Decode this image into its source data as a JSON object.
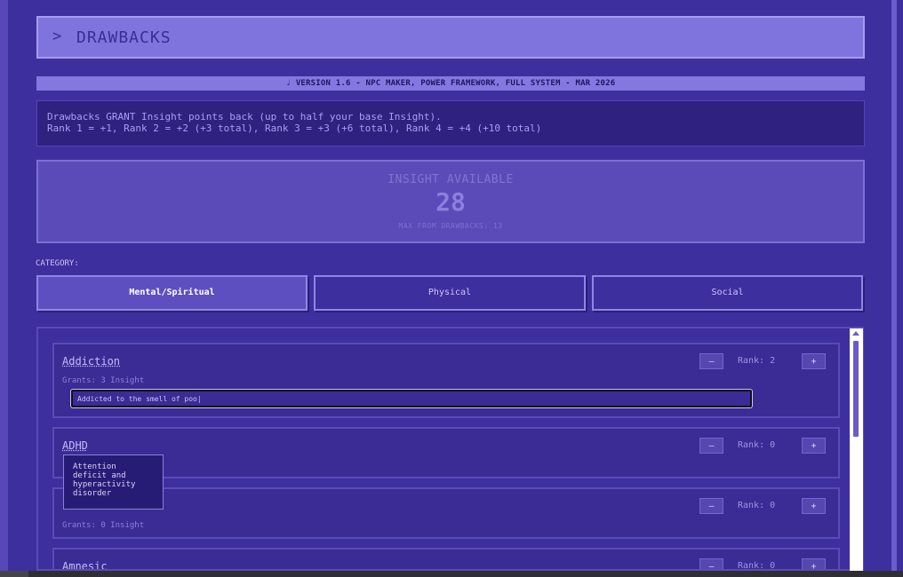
{
  "header": {
    "chevron": ">",
    "title": "DRAWBACKS"
  },
  "version": "♩ VERSION 1.6 - NPC MAKER, POWER FRAMEWORK, FULL SYSTEM - MAR 2026",
  "info": {
    "line1": "Drawbacks GRANT Insight points back (up to half your base Insight).",
    "line2": "Rank 1 = +1, Rank 2 = +2 (+3 total), Rank 3 = +3 (+6 total), Rank 4 = +4 (+10 total)"
  },
  "insight": {
    "label": "INSIGHT AVAILABLE",
    "value": "28",
    "max_text": "MAX FROM DRAWBACKS: 13"
  },
  "category_label": "CATEGORY:",
  "tabs": [
    {
      "label": "Mental/Spiritual",
      "active": true
    },
    {
      "label": "Physical",
      "active": false
    },
    {
      "label": "Social",
      "active": false
    }
  ],
  "drawbacks": [
    {
      "name": "Addiction",
      "rank_text": "Rank: 2",
      "grants": "Grants: 3 Insight",
      "note": "Addicted to the smell of poo|"
    },
    {
      "name": "ADHD",
      "rank_text": "Rank: 0",
      "grants": ""
    },
    {
      "name": "",
      "rank_text": "Rank: 0",
      "grants": "Grants: 0 Insight"
    },
    {
      "name": "Amnesic",
      "rank_text": "Rank: 0",
      "grants": ""
    }
  ],
  "buttons": {
    "minus": "–",
    "plus": "+"
  },
  "tooltip": "Attention\ndeficit and\nhyperactivity\ndisorder",
  "colors": {
    "background": "#3e2f9e",
    "header": "#7f74dd",
    "accent": "#8f85e6"
  }
}
